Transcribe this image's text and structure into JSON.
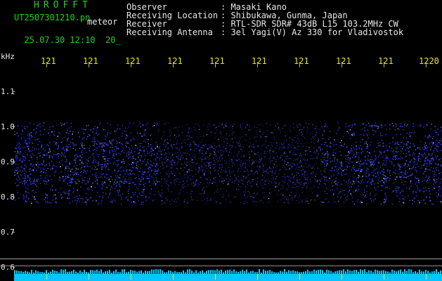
{
  "header": {
    "brand": "HROFFT",
    "file_name": "UT2507301210.pn",
    "mode": "meteor",
    "date_time": "25.07.30 12:10",
    "minute_suffix": "20_"
  },
  "info": [
    {
      "label": "Observer",
      "value": ": Masaki Kano"
    },
    {
      "label": "Receiving Location",
      "value": ": Shibukawa, Gunma, Japan"
    },
    {
      "label": "Receiver",
      "value": ": RTL-SDR SDR# 43dB L15 103.2MHz CW"
    },
    {
      "label": "Receiving Antenna",
      "value": ": 3el Yagi(V) Az 330 for Vladivostok"
    }
  ],
  "yaxis": {
    "unit": "kHz",
    "ticks": [
      "1.1",
      "1.0",
      "0.9",
      "0.8",
      "0.7",
      "0.6"
    ]
  },
  "xaxis": {
    "ticks": [
      "121",
      "121",
      "121",
      "121",
      "121",
      "121",
      "121",
      "121",
      "121",
      "1220"
    ]
  },
  "colors": {
    "background": "#000000",
    "noise_band": "#2a3cff",
    "header_green": "#20d020",
    "tick_yellow": "#e8e800",
    "bottom_strip": "#00c8ff"
  }
}
